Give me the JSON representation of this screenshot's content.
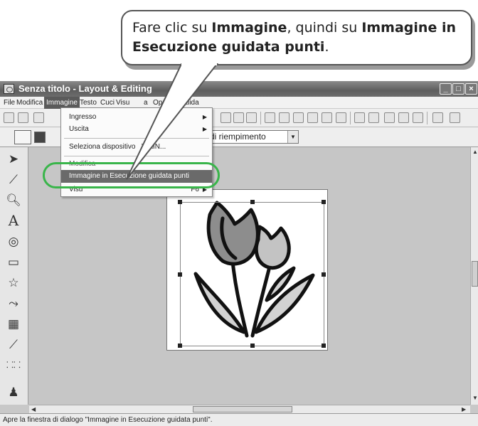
{
  "callout": {
    "line1_a": "Fare clic su ",
    "line1_b": "Immagine",
    "line1_c": ", quindi su ",
    "line1_d": "Immagine in",
    "line2_a": "Esecuzione guidata punti",
    "line2_b": "."
  },
  "window": {
    "title": "Senza titolo - Layout & Editing",
    "min_label": "_",
    "max_label": "□",
    "close_label": "×"
  },
  "menu": {
    "items": [
      "File",
      "Modifica",
      "Immagine",
      "Testo",
      "Cuci",
      "Visualizza",
      "Opzioni",
      "Guida"
    ],
    "active": "Immagine",
    "visible_labels": [
      "File",
      "Modifica",
      "Immagine",
      "Testo",
      "Cuci",
      "Visu",
      "a",
      "Opzioni",
      "Guida"
    ]
  },
  "dropdown": {
    "items": [
      {
        "label": "Ingresso",
        "has_submenu": true
      },
      {
        "label": "Uscita",
        "has_submenu": true
      },
      {
        "label": "Seleziona dispositivo TWAIN...",
        "visible": "Seleziona dispositivo",
        "visible_tail": "WAIN..."
      },
      {
        "label": "Modifica",
        "visible": "Modifica"
      },
      {
        "label": "Immagine in Esecuzione guidata punti",
        "highlighted": true
      },
      {
        "label": "Visualizza",
        "visible": "Visu",
        "shortcut_tail": "F6",
        "has_submenu": true
      }
    ]
  },
  "toolbar2": {
    "fill_combo_value": "di riempimento"
  },
  "status": {
    "text": "Apre la finestra di dialogo \"Immagine in Esecuzione guidata punti\"."
  },
  "icons": {
    "tools": [
      "arrow-select-icon",
      "point-edit-icon",
      "zoom-icon",
      "text-icon",
      "outline-icon",
      "shape-icon",
      "stamp-icon",
      "sew-simulator-icon",
      "pattern-icon",
      "ruler-icon",
      "stitch-icon",
      "figure-icon"
    ]
  },
  "colors": {
    "highlight_ring": "#39b54a",
    "menu_active": "#5a5a5a",
    "titlebar": "#6a6a6a"
  }
}
